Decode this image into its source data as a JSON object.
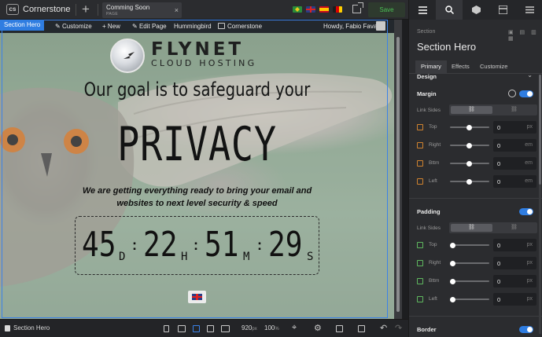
{
  "app": {
    "name": "Cornerstone",
    "logo_text": "cs"
  },
  "page_tab": {
    "title": "Comming Soon",
    "subtitle": "PAGE",
    "close": "×"
  },
  "topbar": {
    "add": "+",
    "save_label": "Save"
  },
  "wp_bar": {
    "customize": "Customize",
    "new": "+ New",
    "edit_page": "Edit Page",
    "hummingbird": "Hummingbird",
    "cornerstone": "Cornerstone",
    "greeting": "Howdy, Fabio Fava",
    "partial": "et"
  },
  "selection_label": "Section Hero",
  "hero": {
    "logo_name": "FLYNET",
    "logo_sub": "CLOUD HOSTING",
    "headline": "Our goal is to safeguard your",
    "big_word": "PRIVACY",
    "subtext_line1": "We are getting everything ready to bring your email and",
    "subtext_line2": "websites to next level security & speed",
    "countdown": {
      "days": "45",
      "days_unit": "D",
      "hours": "22",
      "hours_unit": "H",
      "minutes": "51",
      "minutes_unit": "M",
      "seconds": "29",
      "seconds_unit": "S",
      "separator": ":"
    }
  },
  "bottombar": {
    "breadcrumb": "Section Hero",
    "width_value": "920",
    "width_unit": "px",
    "zoom_value": "100",
    "zoom_unit": "%"
  },
  "panel": {
    "section_label": "Section",
    "section_title": "Section Hero",
    "tabs": [
      "Primary",
      "Effects",
      "Customize"
    ],
    "design_label": "Design",
    "margin": {
      "title": "Margin",
      "link_sides": "Link Sides",
      "rows": [
        {
          "label": "Top",
          "value": "0",
          "unit": "px"
        },
        {
          "label": "Right",
          "value": "0",
          "unit": "em"
        },
        {
          "label": "Bttm",
          "value": "0",
          "unit": "em"
        },
        {
          "label": "Left",
          "value": "0",
          "unit": "em"
        }
      ]
    },
    "padding": {
      "title": "Padding",
      "link_sides": "Link Sides",
      "rows": [
        {
          "label": "Top",
          "value": "0",
          "unit": "px"
        },
        {
          "label": "Right",
          "value": "0",
          "unit": "px"
        },
        {
          "label": "Bttm",
          "value": "0",
          "unit": "px"
        },
        {
          "label": "Left",
          "value": "0",
          "unit": "px"
        }
      ]
    },
    "border": {
      "title": "Border"
    }
  },
  "colors": {
    "accent": "#2f7de1",
    "save": "#4bbf54",
    "margin_icon": "#d0832f",
    "padding_icon": "#5fb85f"
  }
}
